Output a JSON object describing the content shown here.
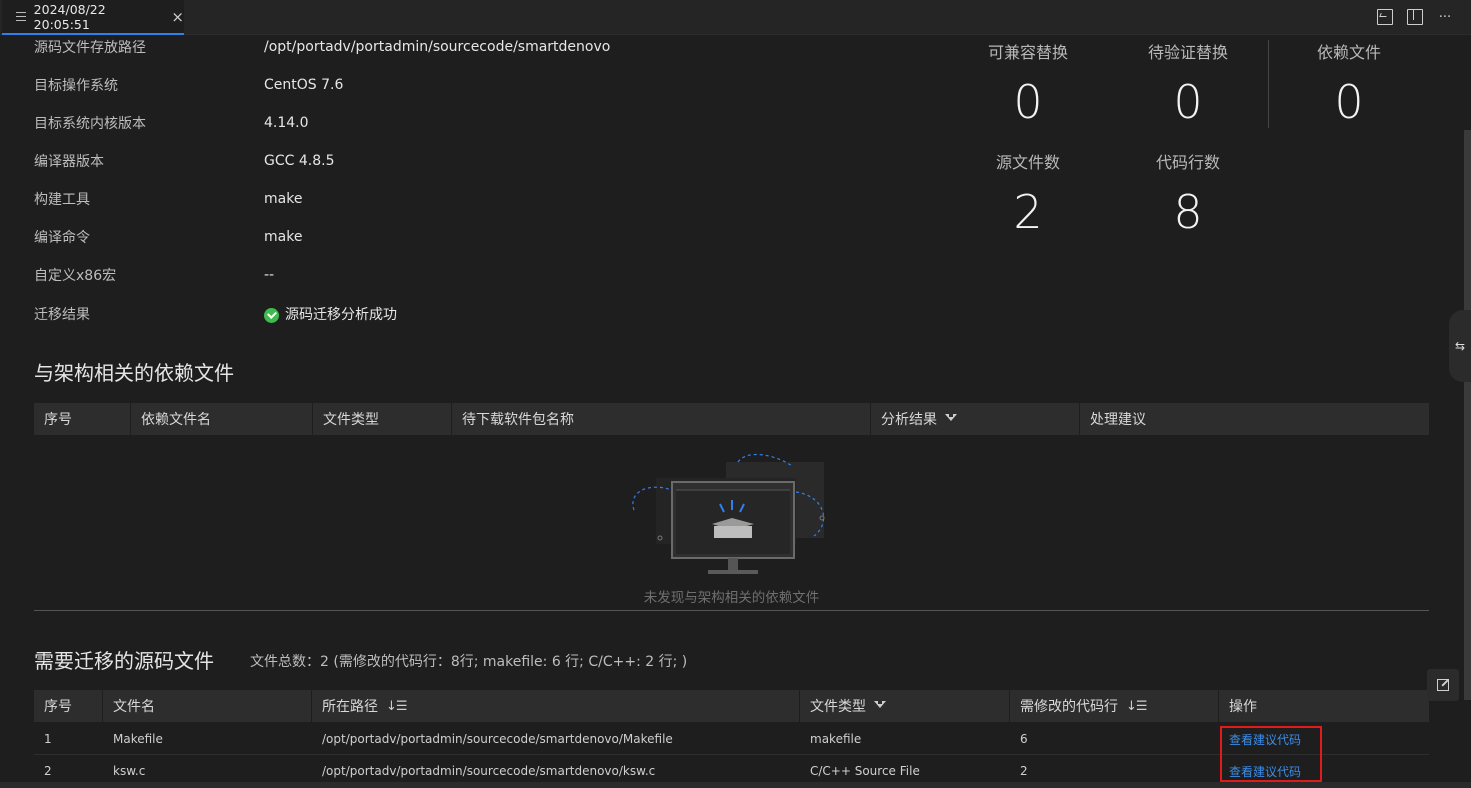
{
  "tab": {
    "title": "2024/08/22 20:05:51",
    "close": "×",
    "more": "···"
  },
  "info": [
    {
      "label": "源码文件存放路径",
      "value": "/opt/portadv/portadmin/sourcecode/smartdenovo"
    },
    {
      "label": "目标操作系统",
      "value": "CentOS 7.6"
    },
    {
      "label": "目标系统内核版本",
      "value": "4.14.0"
    },
    {
      "label": "编译器版本",
      "value": "GCC 4.8.5"
    },
    {
      "label": "构建工具",
      "value": "make"
    },
    {
      "label": "编译命令",
      "value": "make"
    },
    {
      "label": "自定义x86宏",
      "value": "--"
    },
    {
      "label": "迁移结果",
      "value": "源码迁移分析成功"
    }
  ],
  "stats": [
    {
      "label": "可兼容替换",
      "value": "0"
    },
    {
      "label": "待验证替换",
      "value": "0"
    },
    {
      "label": "依赖文件",
      "value": "0"
    },
    {
      "label": "源文件数",
      "value": "2"
    },
    {
      "label": "代码行数",
      "value": "8"
    }
  ],
  "dep_section": {
    "title": "与架构相关的依赖文件",
    "columns": [
      "序号",
      "依赖文件名",
      "文件类型",
      "待下载软件包名称",
      "分析结果",
      "处理建议"
    ],
    "empty_text": "未发现与架构相关的依赖文件"
  },
  "src_section": {
    "title": "需要迁移的源码文件",
    "summary": "文件总数：2 (需修改的代码行：8行; makefile: 6 行; C/C++: 2 行; )",
    "columns": [
      "序号",
      "文件名",
      "所在路径",
      "文件类型",
      "需修改的代码行",
      "操作"
    ],
    "rows": [
      {
        "index": "1",
        "name": "Makefile",
        "path": "/opt/portadv/portadmin/sourcecode/smartdenovo/Makefile",
        "type": "makefile",
        "lines": "6",
        "action": "查看建议代码"
      },
      {
        "index": "2",
        "name": "ksw.c",
        "path": "/opt/portadv/portadmin/sourcecode/smartdenovo/ksw.c",
        "type": "C/C++ Source File",
        "lines": "2",
        "action": "查看建议代码"
      }
    ]
  },
  "colors": {
    "accent": "#2f80ed",
    "link": "#3b8eea",
    "success": "#3fb950",
    "highlight": "#e01b1b"
  }
}
